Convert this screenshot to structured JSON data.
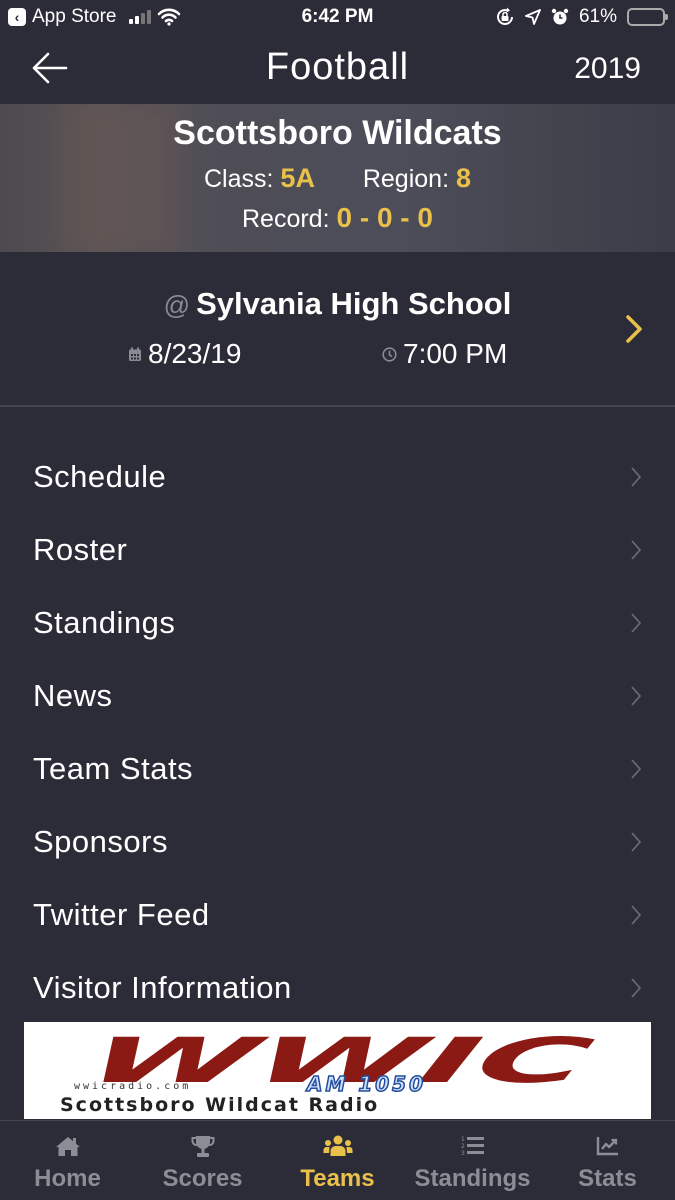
{
  "status_bar": {
    "back_app": "App Store",
    "time": "6:42 PM",
    "battery_percent": "61%",
    "battery_level": 0.61
  },
  "nav": {
    "title": "Football",
    "year": "2019"
  },
  "team": {
    "name": "Scottsboro Wildcats",
    "class_label": "Class:",
    "class_value": "5A",
    "region_label": "Region:",
    "region_value": "8",
    "record_label": "Record:",
    "record_value": "0 - 0 - 0"
  },
  "next_game": {
    "at_symbol": "@",
    "opponent": "Sylvania High School",
    "date": "8/23/19",
    "time": "7:00 PM"
  },
  "menu": [
    {
      "label": "Schedule"
    },
    {
      "label": "Roster"
    },
    {
      "label": "Standings"
    },
    {
      "label": "News"
    },
    {
      "label": "Team Stats"
    },
    {
      "label": "Sponsors"
    },
    {
      "label": "Twitter Feed"
    },
    {
      "label": "Visitor Information"
    }
  ],
  "ad": {
    "logo_text": "WWIC",
    "url": "wwicradio.com",
    "frequency": "AM 1050",
    "tagline": "Scottsboro Wildcat Radio",
    "brand_color": "#8b1a14"
  },
  "tabs": [
    {
      "label": "Home",
      "icon": "home-icon",
      "active": false
    },
    {
      "label": "Scores",
      "icon": "trophy-icon",
      "active": false
    },
    {
      "label": "Teams",
      "icon": "users-icon",
      "active": true
    },
    {
      "label": "Standings",
      "icon": "ordered-list-icon",
      "active": false
    },
    {
      "label": "Stats",
      "icon": "chart-line-icon",
      "active": false
    }
  ],
  "colors": {
    "background": "#2c2c38",
    "accent": "#e8c04a",
    "inactive": "#8d8d95"
  }
}
